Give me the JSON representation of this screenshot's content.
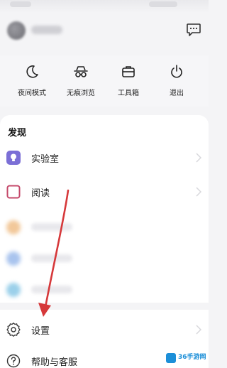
{
  "quick_actions": [
    {
      "label": "夜间模式",
      "icon": "moon-icon"
    },
    {
      "label": "无痕浏览",
      "icon": "incognito-icon"
    },
    {
      "label": "工具箱",
      "icon": "toolbox-icon"
    },
    {
      "label": "退出",
      "icon": "power-icon"
    }
  ],
  "discover": {
    "title": "发现",
    "items": [
      {
        "label": "实验室",
        "icon": "lab-icon"
      },
      {
        "label": "阅读",
        "icon": "reading-icon"
      }
    ]
  },
  "bottom_menu": [
    {
      "label": "设置",
      "icon": "gear-icon"
    },
    {
      "label": "帮助与客服",
      "icon": "help-icon"
    }
  ],
  "watermark": {
    "text": "36手游网",
    "icon": "logo-icon"
  },
  "colors": {
    "accent_purple": "#7b6fd6",
    "reading_icon_red": "#c4486a",
    "annotation_arrow": "#d6383a",
    "watermark_blue": "#1c8fd8"
  }
}
